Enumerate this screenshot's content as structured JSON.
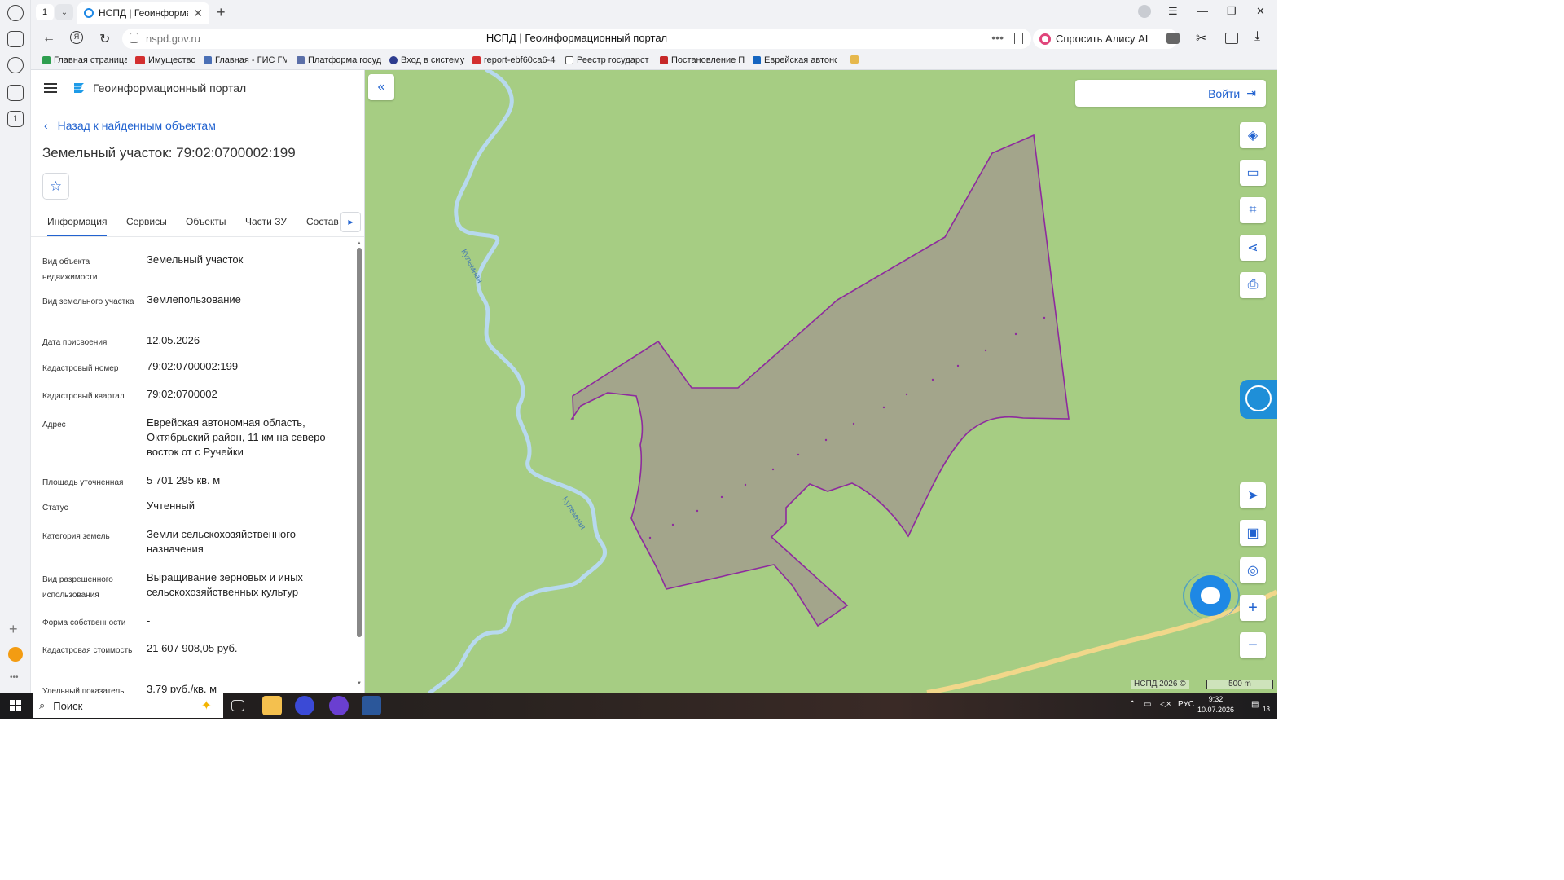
{
  "browser": {
    "tab_count": "1",
    "tab_title": "НСПД | Геоинформаци",
    "url_host": "nspd.gov.ru",
    "page_title": "НСПД | Геоинформационный портал",
    "alice_label": "Спросить Алису AI",
    "bookmarks": [
      "Главная страница",
      "Имущество",
      "Главная - ГИС ГМ",
      "Платформа госуд",
      "Вход в систему",
      "report-ebf60ca6-4",
      "Реестр государст",
      "Постановление П",
      "Еврейская автонс"
    ]
  },
  "panel": {
    "portal_title": "Геоинформационный портал",
    "back_label": "Назад к найденным объектам",
    "object_title": "Земельный участок: 79:02:0700002:199",
    "tabs": [
      "Информация",
      "Сервисы",
      "Объекты",
      "Части ЗУ",
      "Состав"
    ],
    "properties": [
      {
        "key": "Вид объекта недвижимости",
        "value": "Земельный участок"
      },
      {
        "key": "Вид земельного участка",
        "value": "Землепользование"
      },
      {
        "key": "Дата присвоения",
        "value": "12.05.2026"
      },
      {
        "key": "Кадастровый номер",
        "value": "79:02:0700002:199"
      },
      {
        "key": "Кадастровый квартал",
        "value": "79:02:0700002"
      },
      {
        "key": "Адрес",
        "value": "Еврейская автономная область, Октябрьский район, 11 км на северо-восток от с Ручейки"
      },
      {
        "key": "Площадь уточненная",
        "value": "5 701 295 кв. м"
      },
      {
        "key": "Статус",
        "value": "Учтенный"
      },
      {
        "key": "Категория земель",
        "value": "Земли сельскохозяйственного назначения"
      },
      {
        "key": "Вид разрешенного использования",
        "value": "Выращивание зерновых и иных сельскохозяйственных культур"
      },
      {
        "key": "Форма собственности",
        "value": "-"
      },
      {
        "key": "Кадастровая стоимость",
        "value": "21 607 908,05 руб."
      },
      {
        "key": "Удельный показатель",
        "value": "3,79 руб./кв. м"
      }
    ]
  },
  "map": {
    "login_label": "Войти",
    "river_label_1": "Кулемная",
    "river_label_2": "Кулемная",
    "attribution": "НСПД 2026 ©",
    "scale_label": "500 m",
    "colors": {
      "background": "#a6cd83",
      "parcel_fill": "#a3a58b",
      "parcel_stroke": "#8e2a9e",
      "river": "#b7d9ee",
      "road": "#f1d78a"
    }
  },
  "taskbar": {
    "search_label": "Поиск",
    "lang": "РУС",
    "time": "9:32",
    "date": "10.07.2026",
    "notif_count": "13"
  }
}
